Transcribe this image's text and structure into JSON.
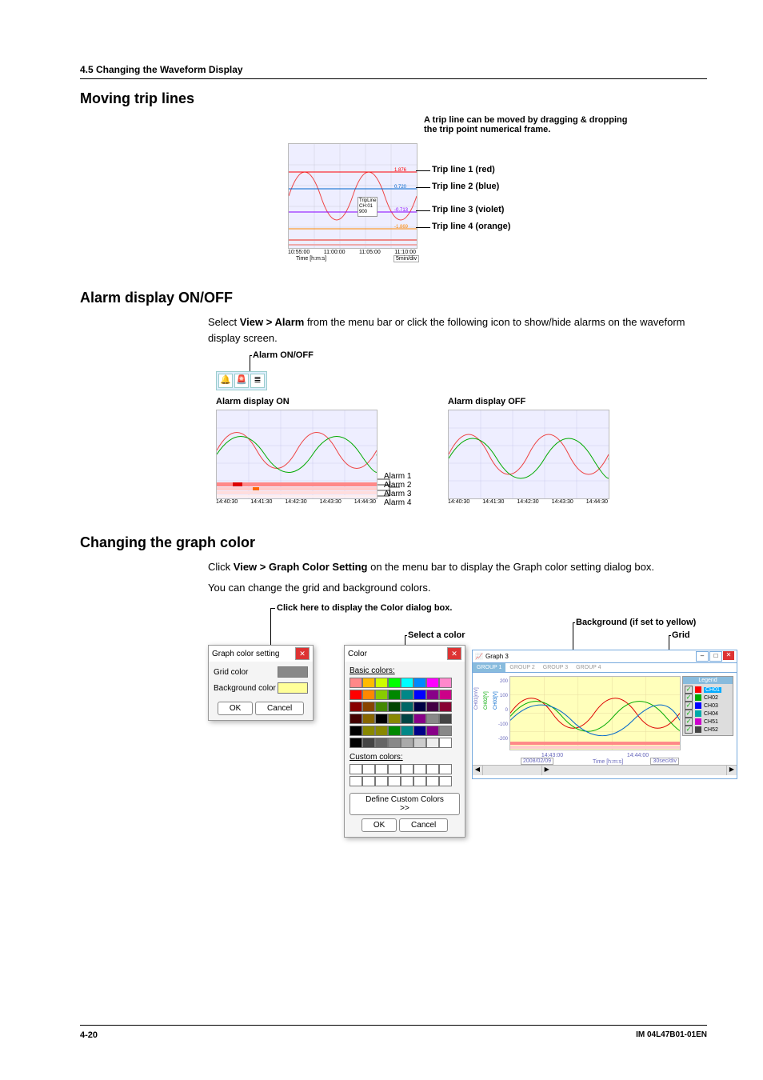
{
  "section_header": "4.5  Changing the Waveform Display",
  "h1": "Moving trip lines",
  "trip_note": "A trip line can be moved by dragging & dropping the trip point numerical frame.",
  "trip_lines": {
    "l1": "Trip line 1 (red)",
    "l2": "Trip line 2 (blue)",
    "l3": "Trip line 3 (violet)",
    "l4": "Trip line 4 (orange)"
  },
  "trip_vals": {
    "v1": "1.876",
    "v2": "0.720",
    "v3": "-0.713",
    "v4": "-1.869"
  },
  "trip_xticks": [
    "10:55:00",
    "11:00:00",
    "11:05:00",
    "11:10:00"
  ],
  "trip_xlabel": "Time [h:m:s]",
  "trip_scale": "5min/div",
  "h2": "Alarm display ON/OFF",
  "alarm_text_1": "Select ",
  "alarm_text_1b": "View > Alarm",
  "alarm_text_1c": " from the menu bar or click the following icon to show/hide alarms on the waveform display screen.",
  "alarm_onoff_label": "Alarm ON/OFF",
  "alarm_on": "Alarm display ON",
  "alarm_off": "Alarm display OFF",
  "alarm_labels": {
    "a1": "Alarm 1",
    "a2": "Alarm 2",
    "a3": "Alarm 3",
    "a4": "Alarm 4"
  },
  "alarm_xticks": [
    "14:40:30",
    "14:41:30",
    "14:42:30",
    "14:43:30",
    "14:44:30"
  ],
  "h3": "Changing the graph color",
  "graph_text_1": "Click ",
  "graph_text_1b": "View > Graph Color Setting",
  "graph_text_1c": " on the menu bar to display the Graph color setting dialog box.",
  "graph_text_2": "You can change the grid and background colors.",
  "click_here": "Click here to display the Color dialog box.",
  "select_color": "Select a color",
  "bg_label": "Background (if set to yellow)",
  "grid_label": "Grid",
  "dialog1": {
    "title": "Graph color setting",
    "row1": "Grid color",
    "row2": "Background color",
    "ok": "OK",
    "cancel": "Cancel"
  },
  "dialog2": {
    "title_c": "Color",
    "basic": "Basic colors:",
    "custom": "Custom colors:",
    "define": "Define Custom Colors >>",
    "ok": "OK",
    "cancel": "Cancel"
  },
  "basic_colors": [
    "#f88",
    "#fb0",
    "#cf0",
    "#0f0",
    "#0ff",
    "#08f",
    "#f0f",
    "#f8c",
    "#f00",
    "#f80",
    "#8c0",
    "#080",
    "#088",
    "#00f",
    "#808",
    "#c08",
    "#800",
    "#840",
    "#480",
    "#040",
    "#066",
    "#004",
    "#404",
    "#803",
    "#400",
    "#860",
    "#000",
    "#880",
    "#044",
    "#808",
    "#888",
    "#444",
    "#000",
    "#880",
    "#880",
    "#080",
    "#088",
    "#008",
    "#808",
    "#888",
    "#000",
    "#444",
    "#666",
    "#888",
    "#aaa",
    "#ccc",
    "#eee",
    "#fff"
  ],
  "wave3": {
    "title": "Graph 3",
    "tabs": [
      "GROUP 1",
      "GROUP 2",
      "GROUP 3",
      "GROUP 4"
    ],
    "yticks": [
      "200",
      "100",
      "0",
      "-100",
      "-200"
    ],
    "ylabel": "CH01[mV]",
    "ylabel2": "CH02[V]",
    "ylabel3": "CH03[V]",
    "xticks": [
      "14:43:00",
      "14:44:00"
    ],
    "xdate": "2008/02/09",
    "xlabel": "Time [h:m:s]",
    "scale": "30sec/div",
    "legend_title": "Legend",
    "legend": [
      {
        "ch": "CH01",
        "color": "#f00"
      },
      {
        "ch": "CH02",
        "color": "#0a0"
      },
      {
        "ch": "CH03",
        "color": "#00f"
      },
      {
        "ch": "CH04",
        "color": "#0aa"
      },
      {
        "ch": "CH51",
        "color": "#c0c"
      },
      {
        "ch": "CH52",
        "color": "#444"
      }
    ]
  },
  "footer": {
    "page": "4-20",
    "doc": "IM 04L47B01-01EN"
  }
}
